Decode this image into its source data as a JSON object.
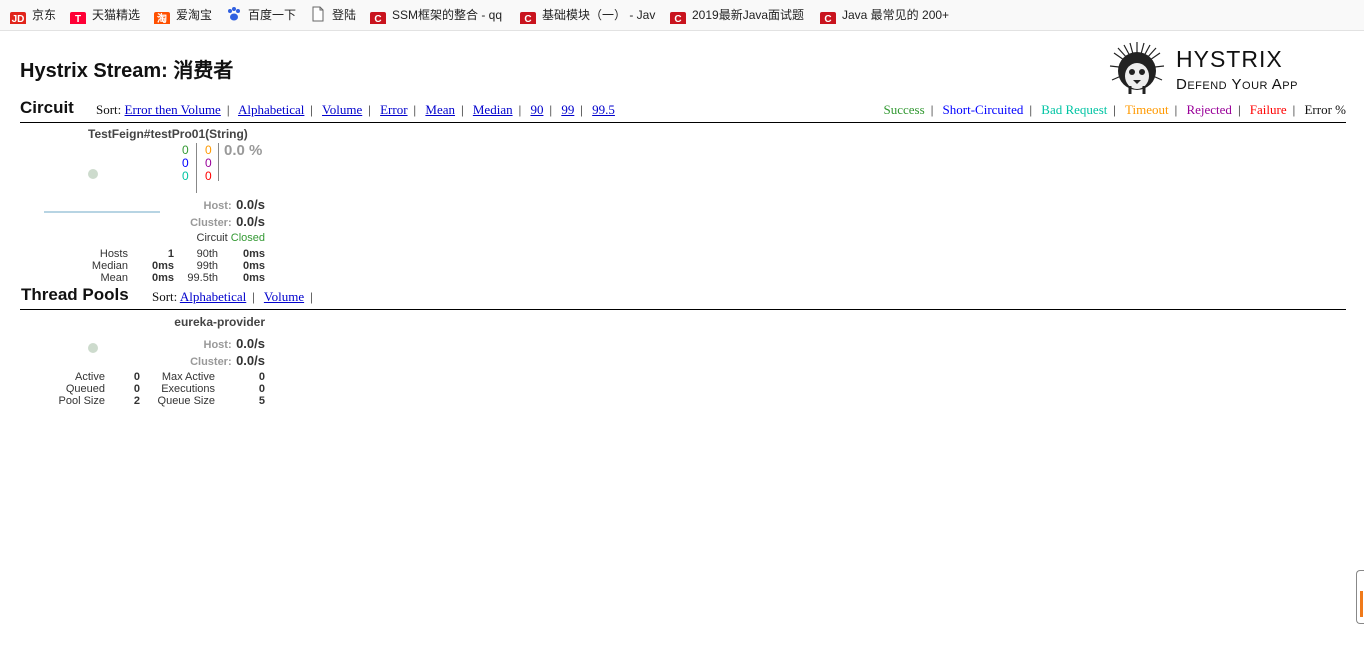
{
  "bookmarks": [
    {
      "label": "京东",
      "icon": "jd-icon"
    },
    {
      "label": "天猫精选",
      "icon": "tmall-icon"
    },
    {
      "label": "爱淘宝",
      "icon": "taobao-icon"
    },
    {
      "label": "百度一下",
      "icon": "baidu-icon"
    },
    {
      "label": "登陆",
      "icon": "page-icon"
    },
    {
      "label": "SSM框架的整合 - qq",
      "icon": "csdn-icon"
    },
    {
      "label": "基础模块（一） - Jav",
      "icon": "csdn-icon"
    },
    {
      "label": "2019最新Java面试题",
      "icon": "csdn-icon"
    },
    {
      "label": "Java 最常见的 200+",
      "icon": "csdn-icon"
    }
  ],
  "page_title": "Hystrix Stream: 消费者",
  "logo": {
    "line1": "Hystrix",
    "line2": "Defend Your App"
  },
  "circuit": {
    "title": "Circuit",
    "sort_label": "Sort:",
    "sort_links": [
      "Error then Volume",
      "Alphabetical",
      "Volume",
      "Error",
      "Mean",
      "Median",
      "90",
      "99",
      "99.5"
    ],
    "legend": [
      {
        "label": "Success",
        "color": "#339933"
      },
      {
        "label": "Short-Circuited",
        "color": "#0000ff"
      },
      {
        "label": "Bad Request",
        "color": "#00c4a3"
      },
      {
        "label": "Timeout",
        "color": "#ff9900"
      },
      {
        "label": "Rejected",
        "color": "#990099"
      },
      {
        "label": "Failure",
        "color": "#ff0000"
      },
      {
        "label": "Error %",
        "color": "#111111"
      }
    ],
    "card": {
      "name": "TestFeign#testPro01(String)",
      "success": "0",
      "short_circuited": "0",
      "bad_request": "0",
      "timeout": "0",
      "rejected": "0",
      "failure": "0",
      "error_pct": "0.0 %",
      "host_label": "Host:",
      "host_rate": "0.0/s",
      "cluster_label": "Cluster:",
      "cluster_rate": "0.0/s",
      "circuit_label": "Circuit",
      "circuit_status": "Closed",
      "stats": {
        "hosts_label": "Hosts",
        "hosts": "1",
        "median_label": "Median",
        "median": "0ms",
        "mean_label": "Mean",
        "mean": "0ms",
        "p90_label": "90th",
        "p90": "0ms",
        "p99_label": "99th",
        "p99": "0ms",
        "p995_label": "99.5th",
        "p995": "0ms"
      }
    }
  },
  "thread_pools": {
    "title": "Thread Pools",
    "sort_label": "Sort:",
    "sort_links": [
      "Alphabetical",
      "Volume"
    ],
    "card": {
      "name": "eureka-provider",
      "host_label": "Host:",
      "host_rate": "0.0/s",
      "cluster_label": "Cluster:",
      "cluster_rate": "0.0/s",
      "stats": {
        "active_label": "Active",
        "active": "0",
        "queued_label": "Queued",
        "queued": "0",
        "pool_size_label": "Pool Size",
        "pool_size": "2",
        "max_active_label": "Max Active",
        "max_active": "0",
        "executions_label": "Executions",
        "executions": "0",
        "queue_size_label": "Queue Size",
        "queue_size": "5"
      }
    }
  }
}
